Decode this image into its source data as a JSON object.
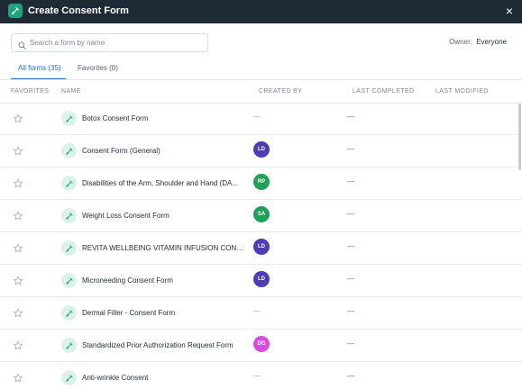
{
  "window": {
    "title": "Create Consent Form",
    "close_label": "×"
  },
  "search": {
    "placeholder": "Search a form by name",
    "value": ""
  },
  "owner": {
    "label": "Owner:",
    "value": "Everyone"
  },
  "tabs": [
    {
      "label": "All forms (35)",
      "active": true
    },
    {
      "label": "Favorites (0)",
      "active": false
    }
  ],
  "columns": {
    "favorites": "FAVORITES",
    "name": "NAME",
    "created_by": "CREATED BY",
    "last_completed": "LAST COMPLETED",
    "last_modified": "LAST MODIFIED"
  },
  "rows": [
    {
      "name": "Botox Consent Form",
      "created_by": "—",
      "avatar_color": "",
      "last_completed": "—"
    },
    {
      "name": "Consent Form (General)",
      "created_by": "LD",
      "avatar_color": "#4f3bb5",
      "last_completed": "—"
    },
    {
      "name": "Disabilities of the Arm, Shoulder and Hand (DA...",
      "created_by": "RP",
      "avatar_color": "#21a05a",
      "last_completed": "—"
    },
    {
      "name": "Weight Loss Consent Form",
      "created_by": "SA",
      "avatar_color": "#21a05a",
      "last_completed": "—"
    },
    {
      "name": "REVITA WELLBEING VITAMIN INFUSION CONS...",
      "created_by": "LD",
      "avatar_color": "#4f3bb5",
      "last_completed": "—"
    },
    {
      "name": "Microneeding Consent Form",
      "created_by": "LD",
      "avatar_color": "#4f3bb5",
      "last_completed": "—"
    },
    {
      "name": "Dermal Filler - Consent Form",
      "created_by": "—",
      "avatar_color": "",
      "last_completed": "—"
    },
    {
      "name": "Standardized Prior Authorization Request Form",
      "created_by": "DG",
      "avatar_color": "#d94ae0",
      "last_completed": "—"
    },
    {
      "name": "Anti-wrinkle Consent",
      "created_by": "—",
      "avatar_color": "",
      "last_completed": "—"
    }
  ],
  "colors": {
    "header_bg": "#1f2a37",
    "accent_green": "#21a17c",
    "tab_active": "#1f6fd1"
  },
  "icons": {
    "title": "pen-icon",
    "search": "search-icon",
    "favorite": "star-outline-icon",
    "form": "pen-icon"
  }
}
